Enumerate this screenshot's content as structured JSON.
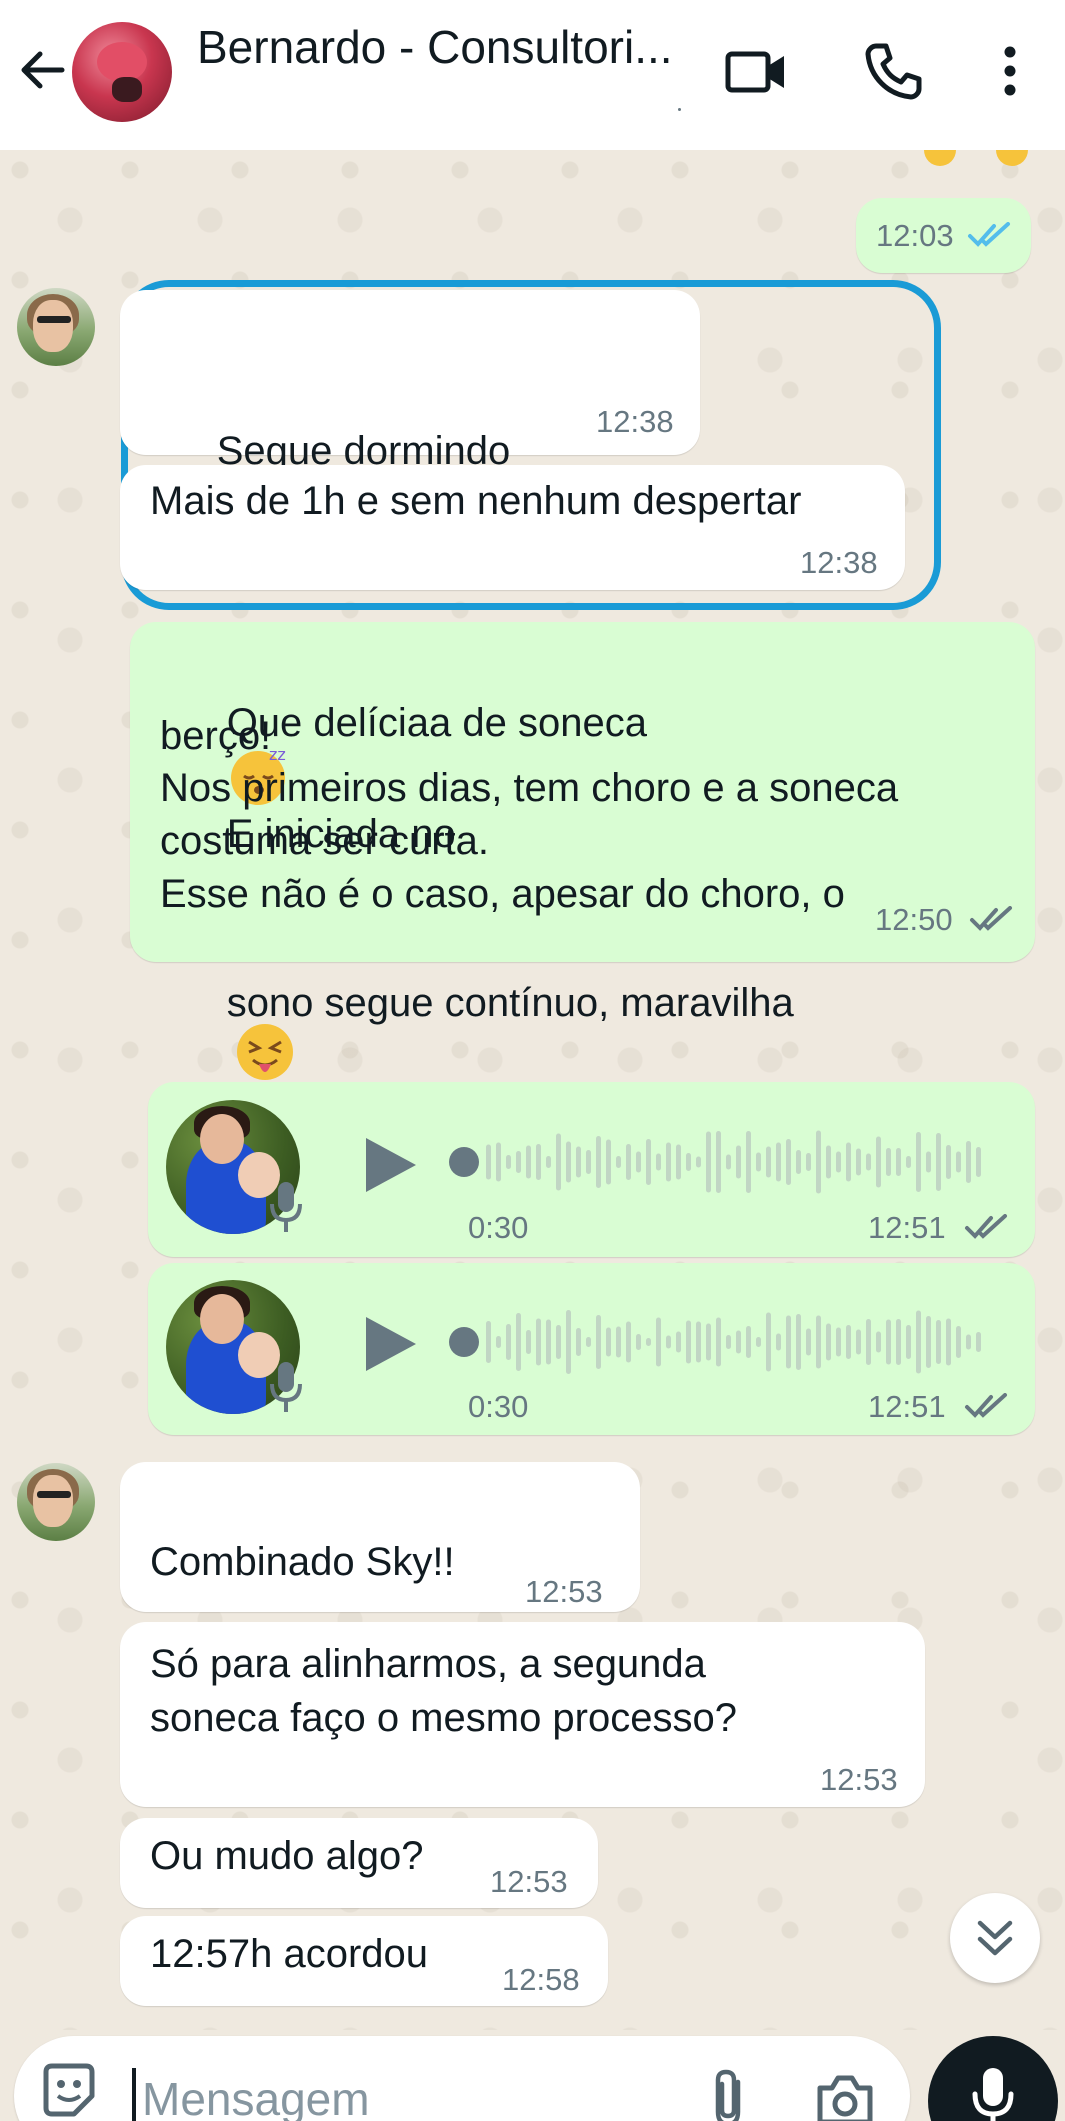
{
  "header": {
    "contact_name": "Bernardo - Consultori..."
  },
  "messages": {
    "m1_time": "12:03",
    "m2_text": "Segue dormindo",
    "m2_time": "12:38",
    "m3_text": "Mais de 1h e sem nenhum despertar",
    "m3_time": "12:38",
    "m4_line1": "Que delíciaa de soneca",
    "m4_line1b": "E iniciada no",
    "m4_line2": "berço!",
    "m4_line3": "Nos primeiros dias, tem choro e a soneca",
    "m4_line4": "costuma ser curta.",
    "m4_line5": "Esse não é o caso, apesar do choro, o",
    "m4_line6": "sono segue contínuo, maravilha",
    "m4_time": "12:50",
    "vn1_duration": "0:30",
    "vn1_time": "12:51",
    "vn2_duration": "0:30",
    "vn2_time": "12:51",
    "m5_text": "Combinado Sky!!",
    "m5_time": "12:53",
    "m6_line1": "Só para alinharmos, a segunda",
    "m6_line2": "soneca faço o mesmo processo?",
    "m6_time": "12:53",
    "m7_text": "Ou mudo algo?",
    "m7_time": "12:53",
    "m8_text": "12:57h acordou",
    "m8_time": "12:58"
  },
  "input": {
    "placeholder": "Mensagem"
  },
  "colors": {
    "incoming_bubble": "#ffffff",
    "outgoing_bubble": "#d9fdd3",
    "read_tick": "#53bdeb",
    "highlight_border": "#1a9bd6"
  },
  "icons": {
    "back": "arrow-left-icon",
    "video": "video-camera-icon",
    "call": "phone-icon",
    "menu": "more-vertical-icon",
    "play": "play-icon",
    "mic": "microphone-icon",
    "scroll": "double-chevron-down-icon",
    "sticker": "sticker-icon",
    "attach": "paperclip-icon",
    "camera": "camera-icon"
  }
}
